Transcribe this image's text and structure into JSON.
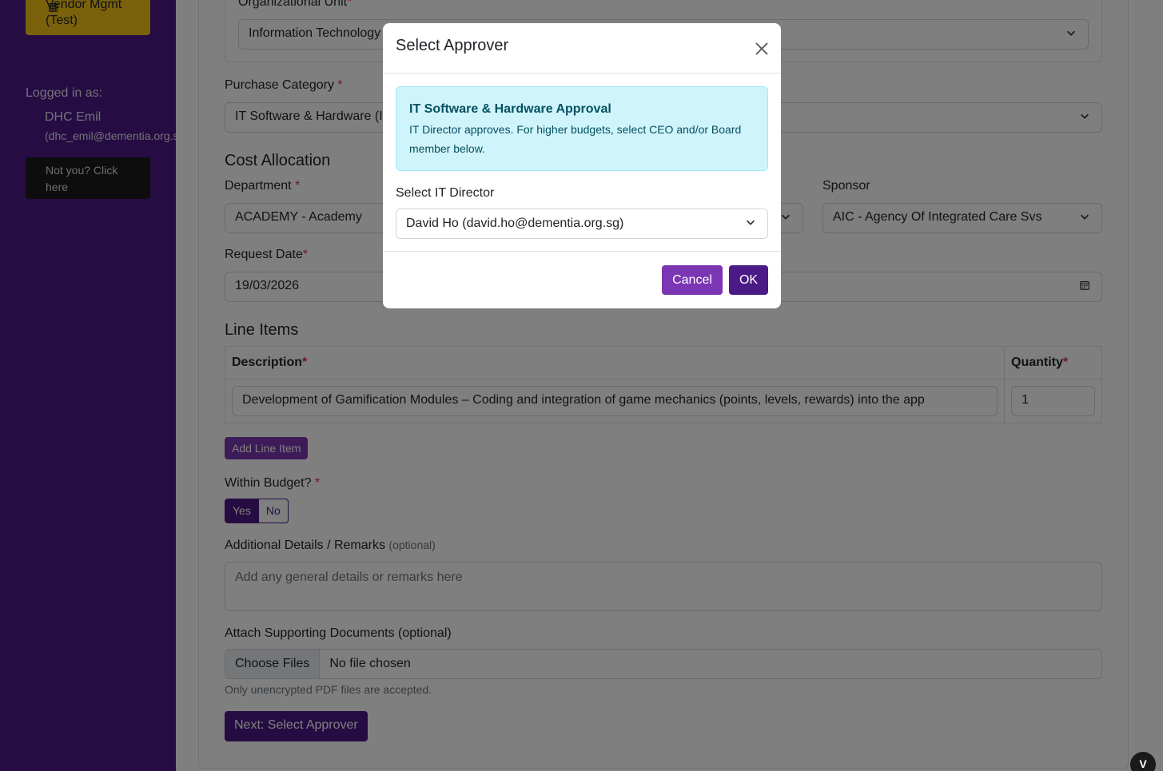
{
  "sidebar": {
    "brand_button": "Vendor Mgmt (Test)",
    "logged_in_label": "Logged in as:",
    "user_name": "DHC Emil",
    "user_email": "(dhc_emil@dementia.org.sg)",
    "not_you_button": "Not you? Click here"
  },
  "form": {
    "org_unit_label": "Organizational Unit",
    "org_unit_value": "Information Technology",
    "purchase_category_label": "Purchase Category",
    "purchase_category_value": "IT Software & Hardware (I",
    "cost_allocation_title": "Cost Allocation",
    "department_label": "Department",
    "department_value": "ACADEMY - Academy",
    "sponsor_label": "Sponsor",
    "sponsor_value": "AIC - Agency Of Integrated Care Svs",
    "request_date_label": "Request Date",
    "request_date_value": "19/03/2026",
    "line_items_title": "Line Items",
    "line_items": {
      "columns": [
        "Description",
        "Quantity"
      ],
      "rows": [
        {
          "description": "Development of Gamification Modules – Coding and integration of game mechanics (points, levels, rewards) into the app",
          "quantity": "1"
        }
      ]
    },
    "add_line_item_button": "Add Line Item",
    "within_budget_label": "Within Budget?",
    "within_budget_yes": "Yes",
    "within_budget_no": "No",
    "remarks_label": "Additional Details / Remarks",
    "remarks_optional": "(optional)",
    "remarks_placeholder": "Add any general details or remarks here",
    "attach_label": "Attach Supporting Documents (optional)",
    "choose_files_button": "Choose Files",
    "no_file_text": "No file chosen",
    "file_hint": "Only unencrypted PDF files are accepted.",
    "next_button": "Next: Select Approver",
    "required_marker": "*"
  },
  "corner_badge": "V",
  "modal": {
    "title": "Select Approver",
    "alert_title": "IT Software & Hardware Approval",
    "alert_text": "IT Director approves. For higher budgets, select CEO and/or Board member below.",
    "select_label": "Select IT Director",
    "select_value": "David Ho (david.ho@dementia.org.sg)",
    "cancel_button": "Cancel",
    "ok_button": "OK"
  },
  "colors": {
    "sidebar_bg": "#4b1a86",
    "brand_button_bg": "#f5c518",
    "primary": "#4b1a86",
    "secondary_purple": "#7a36b3",
    "alert_bg": "#cff4fc",
    "required": "#dc3545"
  }
}
